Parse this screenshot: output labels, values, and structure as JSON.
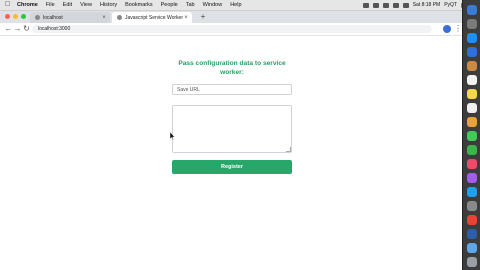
{
  "menubar": {
    "apple": "",
    "items": [
      "Chrome",
      "File",
      "Edit",
      "View",
      "History",
      "Bookmarks",
      "People",
      "Tab",
      "Window",
      "Help"
    ],
    "clock": "Sat 8:18 PM",
    "user": "PyQT"
  },
  "tabs": [
    {
      "title": "localhost",
      "close": "×"
    },
    {
      "title": "Javascript Service Workers",
      "close": "×"
    }
  ],
  "newtab": "+",
  "toolbar": {
    "back": "←",
    "forward": "→",
    "reload": "↻",
    "url": "localhost:3000",
    "menu": "⋮"
  },
  "colors": {
    "accent_green": "#27a86a",
    "heading_green": "#27a067"
  },
  "page": {
    "heading": "Pass configuration data to service worker:",
    "url_placeholder": "Save URL",
    "textarea_value": "",
    "register_label": "Register"
  }
}
